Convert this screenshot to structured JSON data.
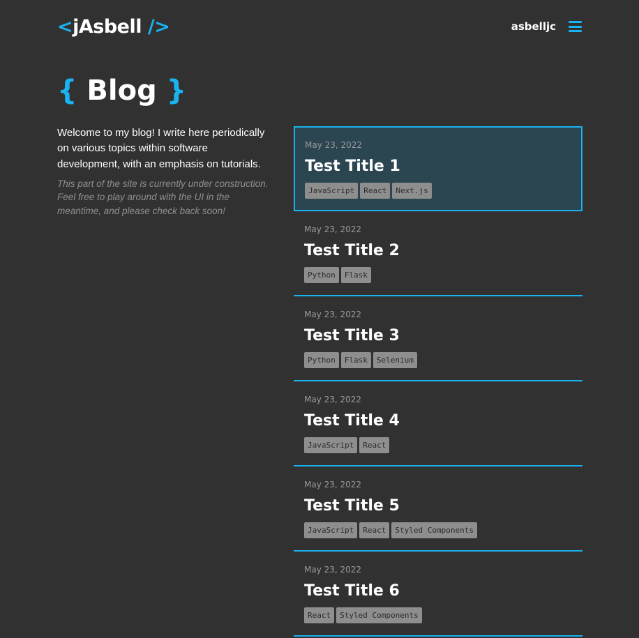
{
  "header": {
    "logo_open": "<",
    "logo_name": "jAsbell",
    "logo_close": "/>",
    "username": "asbelljc",
    "menu_icon": "hamburger-menu-icon"
  },
  "page": {
    "brace_open": "{",
    "title": "Blog",
    "brace_close": "}"
  },
  "intro": {
    "main": "Welcome to my blog! I write here periodically on various topics within software development, with an emphasis on tutorials.",
    "note": "This part of the site is currently under construction. Feel free to play around with the UI in the meantime, and please check back soon!"
  },
  "colors": {
    "accent": "#1ab2ef",
    "background": "#313131",
    "active_card": "#2b4551",
    "tag_bg": "#8e8e8e"
  },
  "posts": [
    {
      "date": "May 23, 2022",
      "title": "Test Title 1",
      "tags": [
        "JavaScript",
        "React",
        "Next.js"
      ],
      "active": true
    },
    {
      "date": "May 23, 2022",
      "title": "Test Title 2",
      "tags": [
        "Python",
        "Flask"
      ]
    },
    {
      "date": "May 23, 2022",
      "title": "Test Title 3",
      "tags": [
        "Python",
        "Flask",
        "Selenium"
      ]
    },
    {
      "date": "May 23, 2022",
      "title": "Test Title 4",
      "tags": [
        "JavaScript",
        "React"
      ]
    },
    {
      "date": "May 23, 2022",
      "title": "Test Title 5",
      "tags": [
        "JavaScript",
        "React",
        "Styled Components"
      ]
    },
    {
      "date": "May 23, 2022",
      "title": "Test Title 6",
      "tags": [
        "React",
        "Styled Components"
      ]
    }
  ]
}
